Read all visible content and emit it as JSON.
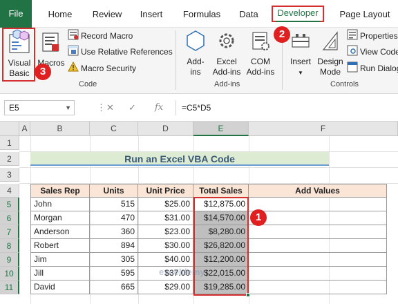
{
  "tabs": [
    "File",
    "Home",
    "Review",
    "Insert",
    "Formulas",
    "Data",
    "Developer",
    "Page Layout"
  ],
  "ribbon": {
    "code": {
      "visual_basic": "Visual\nBasic",
      "visual_basic_l1": "Visual",
      "visual_basic_l2": "Basic",
      "macros": "Macros",
      "record_macro": "Record Macro",
      "relative_refs": "Use Relative References",
      "macro_security": "Macro Security",
      "label": "Code"
    },
    "addins": {
      "addins_l1": "Add-",
      "addins_l2": "ins",
      "excel_addins_l1": "Excel",
      "excel_addins_l2": "Add-ins",
      "com_addins_l1": "COM",
      "com_addins_l2": "Add-ins",
      "label": "Add-ins"
    },
    "controls": {
      "insert": "Insert",
      "design_mode_l1": "Design",
      "design_mode_l2": "Mode",
      "properties": "Properties",
      "view_code": "View Code",
      "run_dialog": "Run Dialog",
      "label": "Controls"
    }
  },
  "formula_bar": {
    "name_box": "E5",
    "fx": "fx",
    "formula": "=C5*D5"
  },
  "columns": [
    "A",
    "B",
    "C",
    "D",
    "E",
    "F"
  ],
  "rows": [
    "1",
    "2",
    "3",
    "4",
    "5",
    "6",
    "7",
    "8",
    "9",
    "10",
    "11"
  ],
  "sheet": {
    "title": "Run an Excel VBA Code",
    "headers": [
      "Sales Rep",
      "Units",
      "Unit Price",
      "Total Sales",
      "Add Values"
    ],
    "data": [
      {
        "rep": "John",
        "units": "515",
        "price": "$25.00",
        "total": "$12,875.00"
      },
      {
        "rep": "Morgan",
        "units": "470",
        "price": "$31.00",
        "total": "$14,570.00"
      },
      {
        "rep": "Anderson",
        "units": "360",
        "price": "$23.00",
        "total": "$8,280.00"
      },
      {
        "rep": "Robert",
        "units": "894",
        "price": "$30.00",
        "total": "$26,820.00"
      },
      {
        "rep": "Jim",
        "units": "305",
        "price": "$40.00",
        "total": "$12,200.00"
      },
      {
        "rep": "Jill",
        "units": "595",
        "price": "$37.00",
        "total": "$22,015.00"
      },
      {
        "rep": "David",
        "units": "665",
        "price": "$29.00",
        "total": "$19,285.00"
      }
    ]
  },
  "badges": [
    "1",
    "2",
    "3"
  ],
  "watermark": "exceldemy",
  "colors": {
    "accent": "#217346",
    "highlight": "#d32f2f",
    "badge": "#e02020"
  }
}
